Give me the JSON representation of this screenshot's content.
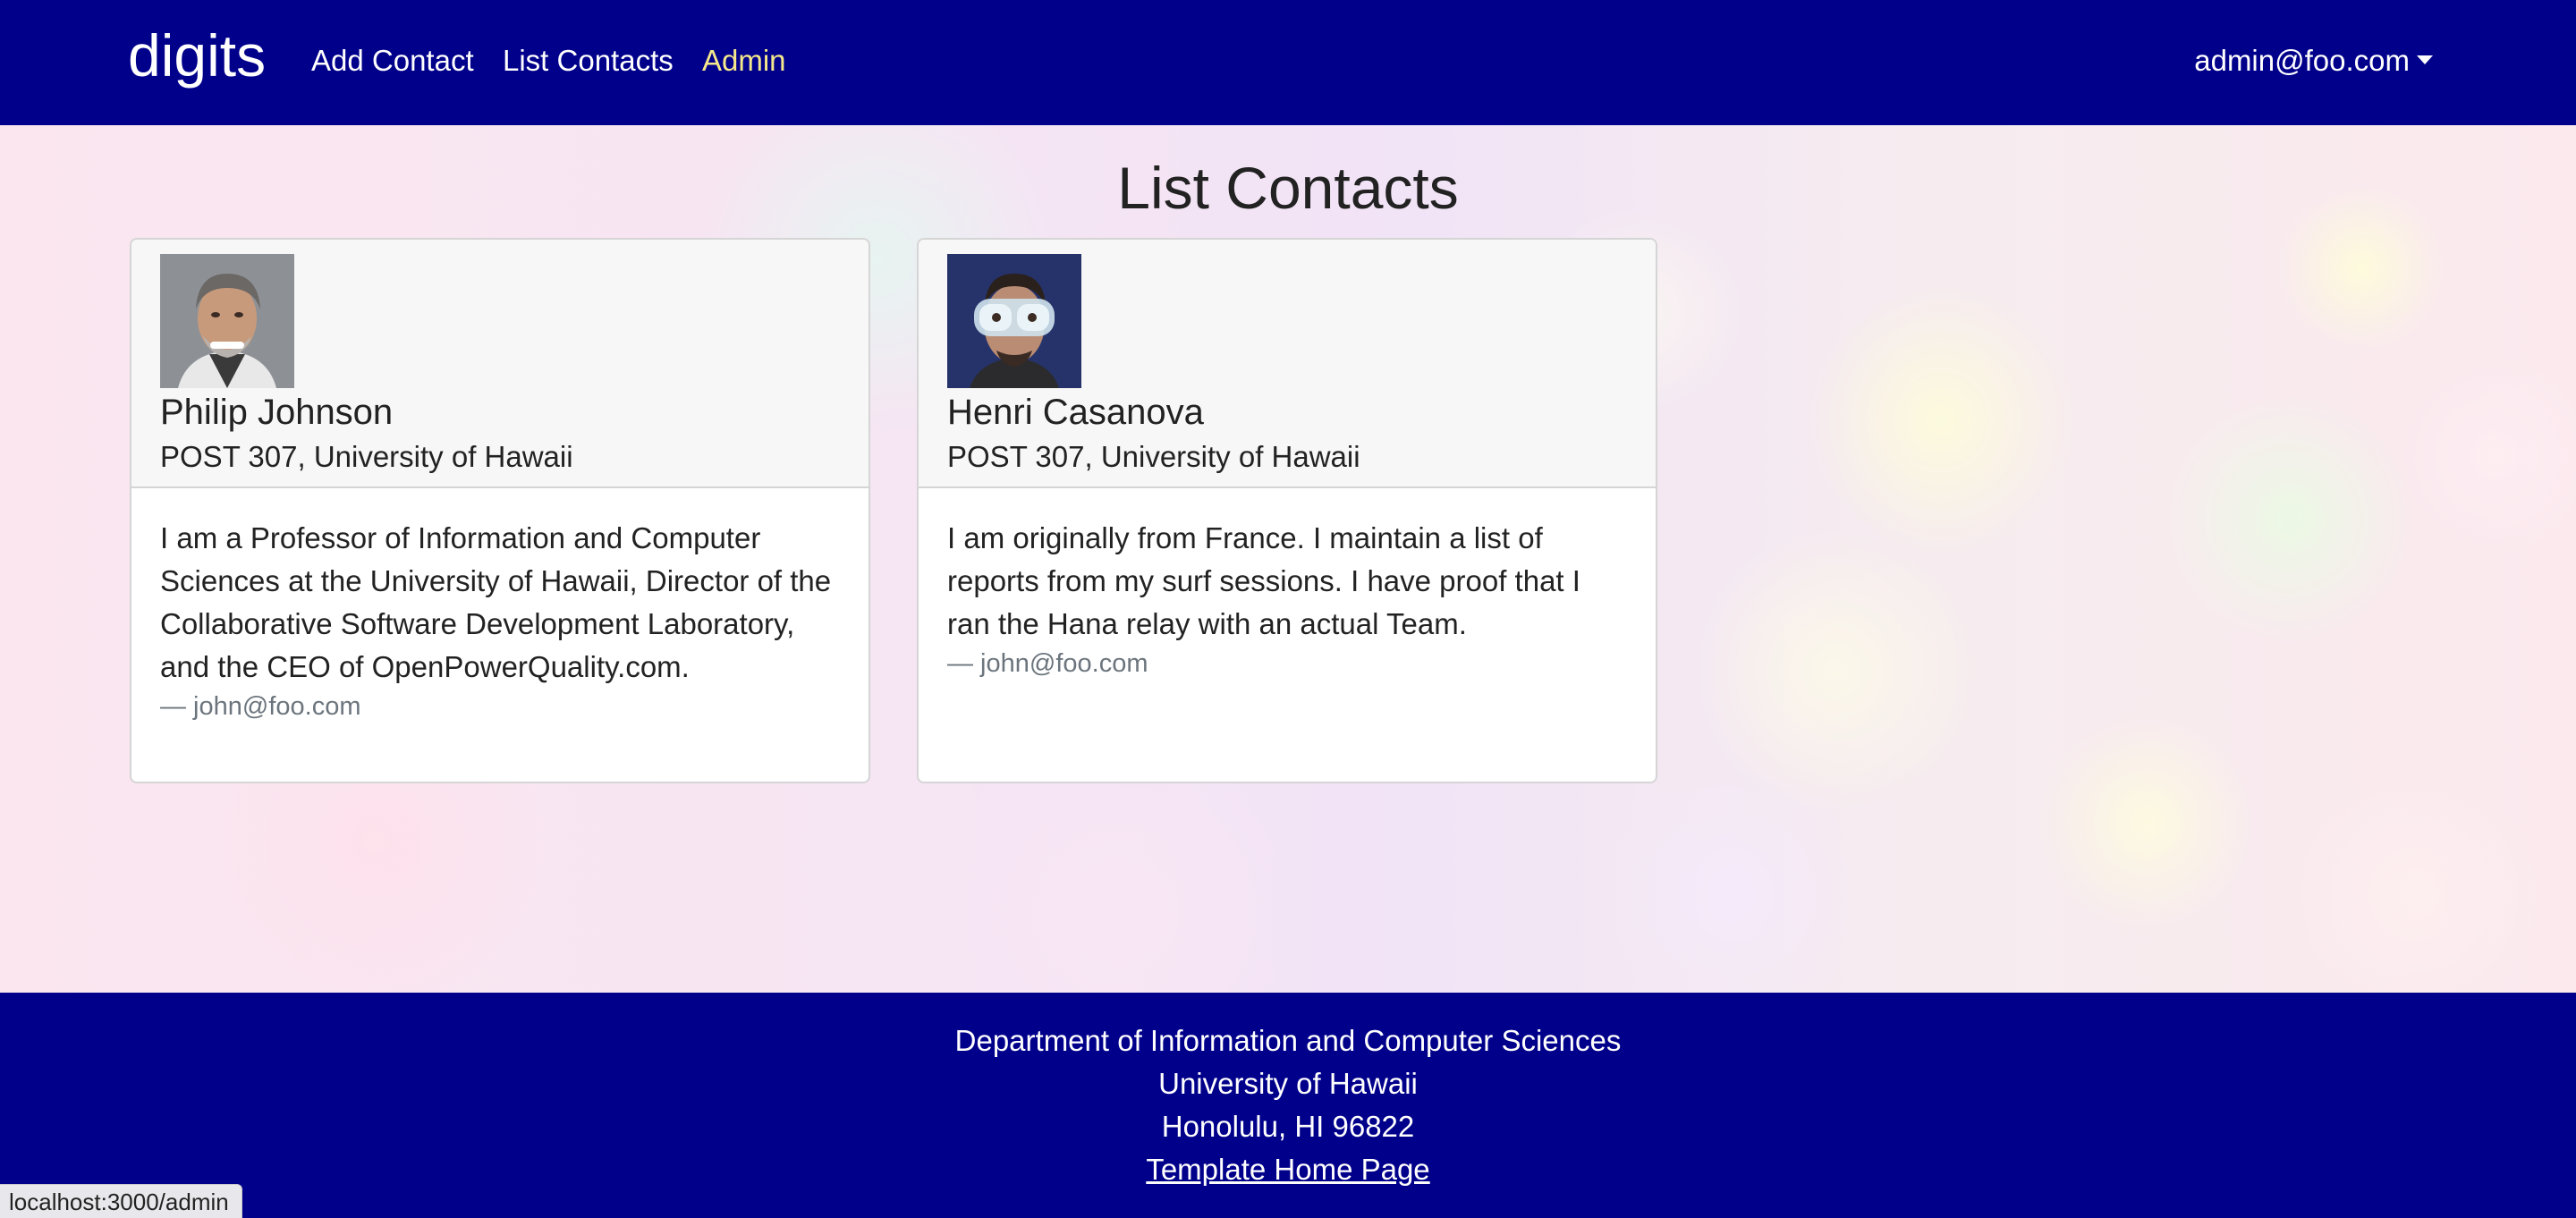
{
  "navbar": {
    "brand": "digits",
    "links": [
      {
        "label": "Add Contact"
      },
      {
        "label": "List Contacts"
      },
      {
        "label": "Admin"
      }
    ],
    "user": "admin@foo.com",
    "background_color": "#00008b",
    "active_link_color": "#f5e88c"
  },
  "page": {
    "title": "List Contacts"
  },
  "contacts": [
    {
      "name": "Philip Johnson",
      "address": "POST 307, University of Hawaii",
      "description": "I am a Professor of Information and Computer Sciences at the University of Hawaii, Director of the Collaborative Software Development Laboratory, and the CEO of OpenPowerQuality.com.",
      "owner": "— john@foo.com",
      "avatar": "photo-of-man-smiling"
    },
    {
      "name": "Henri Casanova",
      "address": "POST 307, University of Hawaii",
      "description": "I am originally from France. I maintain a list of reports from my surf sessions. I have proof that I ran the Hana relay with an actual Team.",
      "owner": "— john@foo.com",
      "avatar": "photo-of-man-in-goggles"
    }
  ],
  "footer": {
    "lines": [
      "Department of Information and Computer Sciences",
      "University of Hawaii",
      "Honolulu, HI 96822"
    ],
    "link_label": "Template Home Page"
  },
  "status_bar": {
    "url": "localhost:3000/admin"
  }
}
